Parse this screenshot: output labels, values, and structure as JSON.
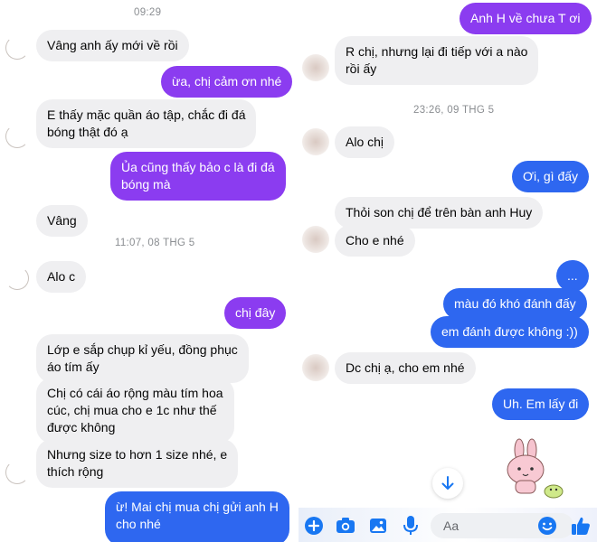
{
  "left": {
    "timestamps": [
      "09:29",
      "11:07, 08 THG 5"
    ],
    "messages": [
      "Vâng anh ấy mới về rồi",
      "ừa, chị cảm ơn nhé",
      "E thấy mặc quần áo tập, chắc đi đá\nbóng thật đó ạ",
      "Ủa cũng thấy bảo c là đi đá\nbóng mà",
      "Vâng",
      "Alo c",
      "chị đây",
      "Lớp e sắp chụp kỉ yếu, đồng phục\náo tím ấy",
      "Chị có cái áo rộng màu tím hoa\ncúc, chị mua cho e 1c như thế\nđược không",
      "Nhưng size to hơn 1 size nhé, e\nthích rộng",
      "ừ! Mai chị mua chị gửi anh H\ncho nhé"
    ]
  },
  "right": {
    "timestamps": [
      "23:26, 09 THG 5"
    ],
    "messages": [
      "Anh H về chưa T ơi",
      "R chị, nhưng lại đi tiếp với a nào\nrồi ấy",
      "Alo chị",
      "Ơi, gì đấy",
      "Thỏi son chị để trên bàn anh Huy",
      "Cho e nhé",
      "...",
      "màu đó khó đánh đấy",
      "em đánh được không :))",
      "Dc chị ạ, cho em nhé",
      "Uh. Em lấy đi"
    ],
    "composer": {
      "placeholder": "Aa",
      "icons": [
        "plus-icon",
        "camera-icon",
        "image-icon",
        "microphone-icon",
        "emoji-icon",
        "thumbs-up-icon",
        "scroll-down-icon",
        "bunny-sticker"
      ]
    }
  },
  "colors": {
    "outgoing_purple": "#8b3cf0",
    "outgoing_blue": "#2e67f0",
    "incoming": "#efeff1",
    "timestamp": "#8a8d91",
    "accent": "#1877f2"
  }
}
